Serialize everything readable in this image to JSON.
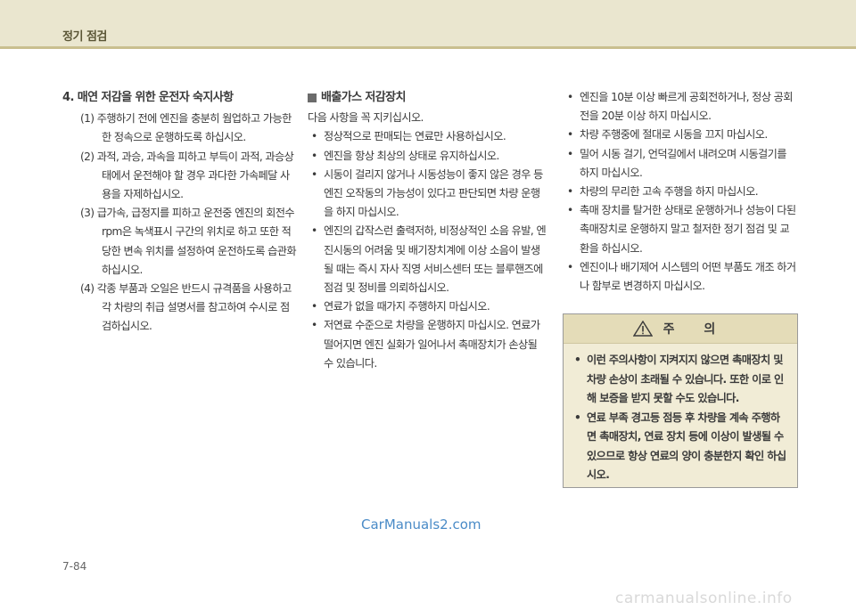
{
  "header": {
    "title": "정기 점검"
  },
  "col1": {
    "title": "4. 매연 저감을 위한 운전자 숙지사항",
    "items": [
      "(1) 주행하기 전에 엔진을 충분히 웜업하고 가능한 한 정속으로 운행하도록 하십시오.",
      "(2) 과적, 과승, 과속을 피하고 부득이 과적, 과승상태에서 운전해야 할 경우 과다한 가속페달 사용을 자제하십시오.",
      "(3) 급가속, 급정지를 피하고 운전중 엔진의 회전수 rpm은 녹색표시 구간의 위치로 하고 또한 적당한 변속 위치를 설정하여 운전하도록 습관화 하십시오.",
      "(4) 각종 부품과 오일은 반드시 규격품을 사용하고 각 차량의 취급 설명서를 참고하여 수시로 점검하십시오."
    ]
  },
  "col2": {
    "title": "배출가스 저감장치",
    "intro": "다음 사항을 꼭 지키십시오.",
    "items": [
      "정상적으로 판매되는 연료만 사용하십시오.",
      "엔진을 항상 최상의 상태로 유지하십시오.",
      "시동이 걸리지 않거나 시동성능이 좋지 않은 경우 등 엔진 오작동의 가능성이 있다고 판단되면 차량 운행을 하지 마십시오.",
      "엔진의 갑작스런 출력저하, 비정상적인 소음 유발, 엔진시동의 어려움 및 배기장치계에 이상 소음이 발생될 때는 즉시 자사 직영 서비스센터 또는 블루핸즈에 점검 및 정비를 의뢰하십시오.",
      "연료가 없을 때가지 주행하지 마십시오.",
      "저연료 수준으로 차량을 운행하지 마십시오. 연료가 떨어지면 엔진 실화가 일어나서 촉매장치가 손상될 수 있습니다."
    ]
  },
  "col3": {
    "items": [
      "엔진을 10분 이상 빠르게 공회전하거나, 정상 공회전을 20분 이상 하지 마십시오.",
      "차량 주행중에 절대로 시동을 끄지 마십시오.",
      "밀어 시동 걸기, 언덕길에서 내려오며 시동걸기를 하지 마십시오.",
      "차량의 무리한 고속 주행을 하지 마십시오.",
      "촉매 장치를 탈거한 상태로 운행하거나 성능이 다된 촉매장치로 운행하지 말고 철저한 정기 점검 및 교환을 하십시오.",
      "엔진이나 배기제어 시스템의 어떤 부품도 개조 하거나 함부로 변경하지 마십시오."
    ]
  },
  "caution": {
    "label": "주 의",
    "icon": "warning-triangle-icon",
    "items": [
      "이런 주의사항이 지켜지지 않으면 촉매장치 및 차량 손상이 초래될 수 있습니다. 또한 이로 인해 보증을 받지 못할 수도 있습니다.",
      "연료 부족 경고등 점등 후 차량을 계속 주행하면 촉매장치, 연료 장치 등에 이상이 발생될 수 있으므로 항상 연료의 양이 충분한지 확인 하십시오."
    ]
  },
  "watermark": "CarManuals2.com",
  "page_number": "7-84",
  "footer_watermark": "carmanualsonline.info"
}
